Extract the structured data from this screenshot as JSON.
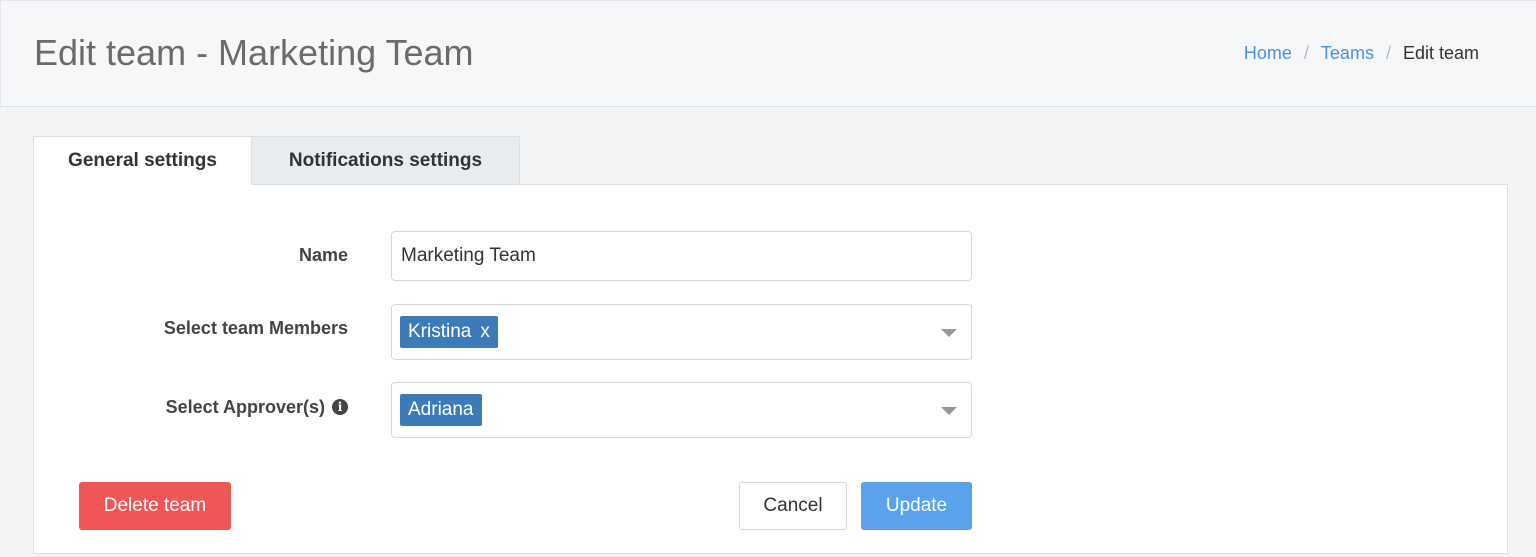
{
  "header": {
    "title": "Edit team - Marketing Team",
    "breadcrumb": {
      "home": "Home",
      "teams": "Teams",
      "current": "Edit team",
      "separator": "/"
    }
  },
  "tabs": [
    {
      "label": "General settings",
      "active": true
    },
    {
      "label": "Notifications settings",
      "active": false
    }
  ],
  "form": {
    "name": {
      "label": "Name",
      "value": "Marketing Team"
    },
    "members": {
      "label": "Select team Members",
      "selected": "Kristina",
      "remove_glyph": "x"
    },
    "approvers": {
      "label": "Select Approver(s)",
      "selected": "Adriana",
      "info_glyph": "i"
    }
  },
  "buttons": {
    "delete": "Delete team",
    "cancel": "Cancel",
    "update": "Update"
  },
  "colors": {
    "link": "#4a90e2",
    "tag": "#3d7ab8",
    "danger": "#ef5656",
    "primary": "#5aa3ea"
  }
}
